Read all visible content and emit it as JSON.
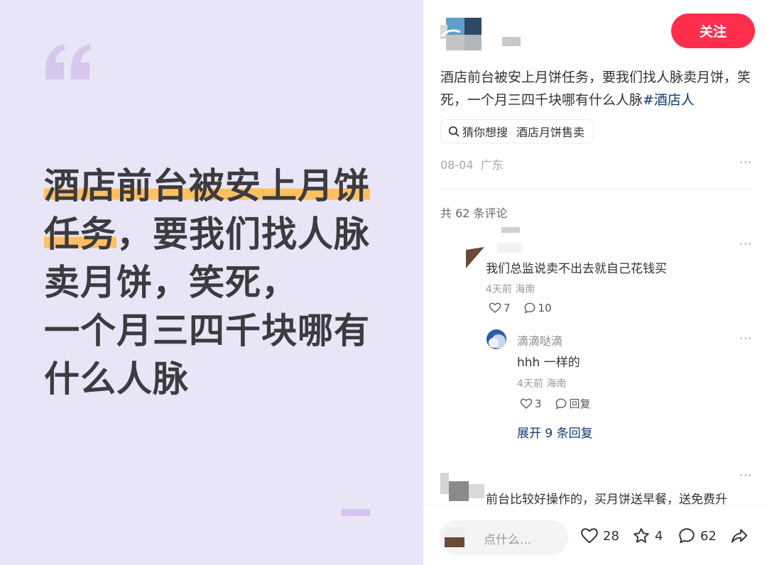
{
  "image_card": {
    "lines": [
      {
        "hl": "酒店前台被安上月饼",
        "rest": ""
      },
      {
        "hl": "任务",
        "rest": "，要我们找人脉"
      },
      {
        "hl": "",
        "rest": "卖月饼，笑死，"
      },
      {
        "hl": "",
        "rest": "一个月三四千块哪有"
      },
      {
        "hl": "",
        "rest": "什么人脉"
      }
    ],
    "icon": "quote-mark-icon"
  },
  "author": {
    "follow_label": "关注"
  },
  "post": {
    "text": "酒店前台被安上月饼任务，要我们找人脉卖月饼，笑死，一个月三四千块哪有什么人脉",
    "hashtag": "#酒店人",
    "search_chip": {
      "label": "猜你想搜",
      "query": "酒店月饼售卖"
    },
    "date": "08-04",
    "location": "广东",
    "more": "···"
  },
  "comments_header": "共 62 条评论",
  "comments": [
    {
      "text": "我们总监说卖不出去就自己花钱买",
      "time": "4天前",
      "location": "海南",
      "likes": "7",
      "replies": "10",
      "more": "···",
      "sub": {
        "name": "滴滴哒滴",
        "text": "hhh 一样的",
        "time": "4天前",
        "location": "海南",
        "likes": "3",
        "reply_label": "回复",
        "more": "···"
      },
      "expand_label": "展开 9 条回复"
    },
    {
      "text": "前台比较好操作的，买月饼送早餐，送免费升",
      "more": "···"
    }
  ],
  "bottom_bar": {
    "placeholder": "点什么...",
    "likes": "28",
    "stars": "4",
    "comments": "62"
  },
  "colors": {
    "accent": "#ff2e4d",
    "link": "#13386c",
    "card_bg": "#e8e5f6",
    "highlight": "#ffc062"
  }
}
